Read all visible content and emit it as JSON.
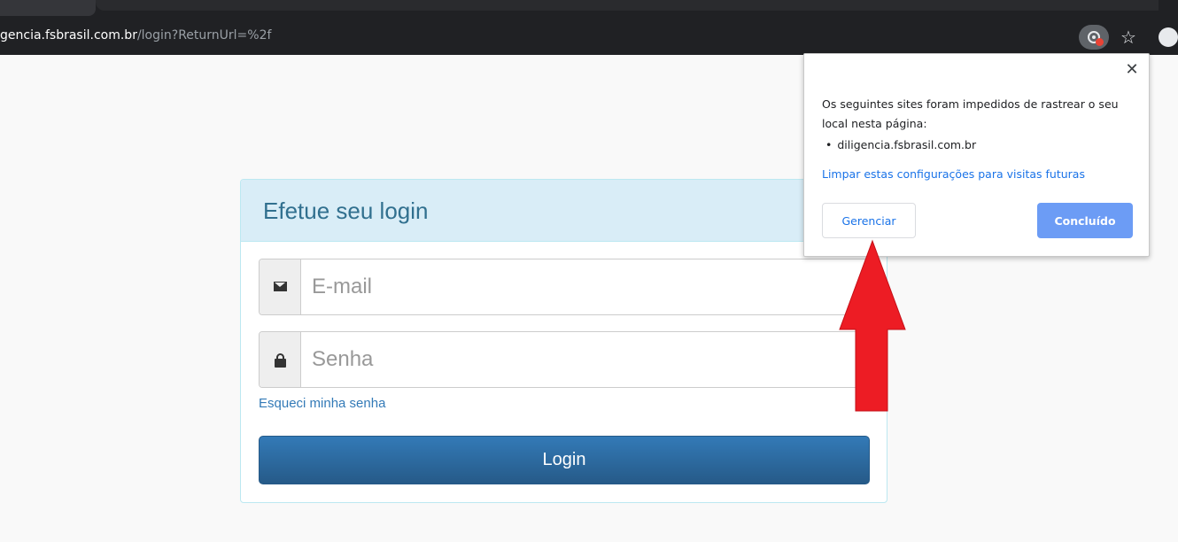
{
  "browser": {
    "url_host": "gencia.fsbrasil.com.br",
    "url_path": "/login?ReturnUrl=%2f",
    "icons": [
      "location-blocked-icon",
      "star-icon",
      "profile-icon"
    ]
  },
  "login": {
    "title": "Efetue seu login",
    "email_placeholder": "E-mail",
    "email_value": "",
    "password_placeholder": "Senha",
    "password_value": "",
    "forgot_label": "Esqueci minha senha",
    "login_button_label": "Login"
  },
  "popup": {
    "message": "Os seguintes sites foram impedidos de rastrear o seu local nesta página:",
    "site": "diligencia.fsbrasil.com.br",
    "clear_link": "Limpar estas configurações para visitas futuras",
    "manage_label": "Gerenciar",
    "done_label": "Concluído",
    "close_symbol": "✕"
  },
  "colors": {
    "panel_heading_bg": "#d9edf7",
    "panel_title": "#31708f",
    "link": "#337ab7",
    "button": "#2e6da4",
    "done_button": "#6c9cf5",
    "annotation_arrow": "#ed1c24"
  }
}
